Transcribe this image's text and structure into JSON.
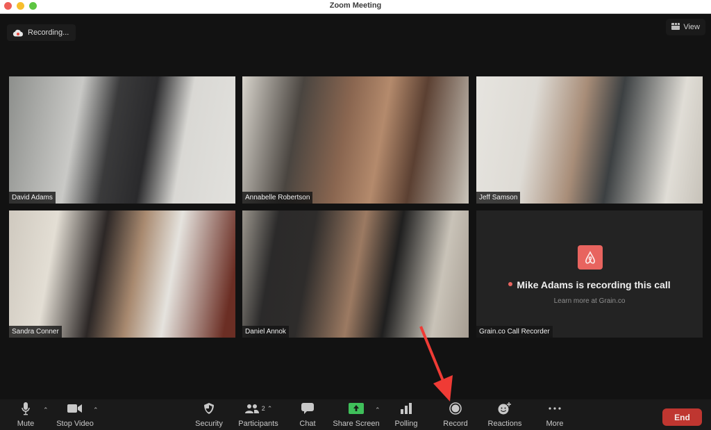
{
  "window": {
    "title": "Zoom Meeting",
    "traffic_lights": {
      "close": "#ee5f58",
      "minimize": "#f7be2e",
      "zoom": "#5dc542"
    }
  },
  "recording_indicator": {
    "icon": "cloud-record-icon",
    "label": "Recording..."
  },
  "view_button": {
    "icon": "grid-view-icon",
    "label": "View"
  },
  "participants": [
    {
      "name": "David Adams"
    },
    {
      "name": "Annabelle Robertson"
    },
    {
      "name": "Jeff Samson"
    },
    {
      "name": "Sandra Conner"
    },
    {
      "name": "Daniel Annok"
    }
  ],
  "recorder_tile": {
    "name": "Grain.co Call Recorder",
    "logo": "grain-logo-icon",
    "message": "Mike Adams is recording this call",
    "sub": "Learn more at Grain.co",
    "accent": "#e8645f"
  },
  "toolbar": {
    "mute": "Mute",
    "stop_video": "Stop Video",
    "security": "Security",
    "participants": "Participants",
    "participants_count": "2",
    "chat": "Chat",
    "share_screen": "Share Screen",
    "polling": "Polling",
    "record": "Record",
    "reactions": "Reactions",
    "more": "More",
    "end": "End",
    "share_color": "#3fbf5a",
    "end_color": "#bf3630"
  },
  "annotation": {
    "type": "arrow",
    "points_to": "Record",
    "color": "#ef3b35"
  }
}
